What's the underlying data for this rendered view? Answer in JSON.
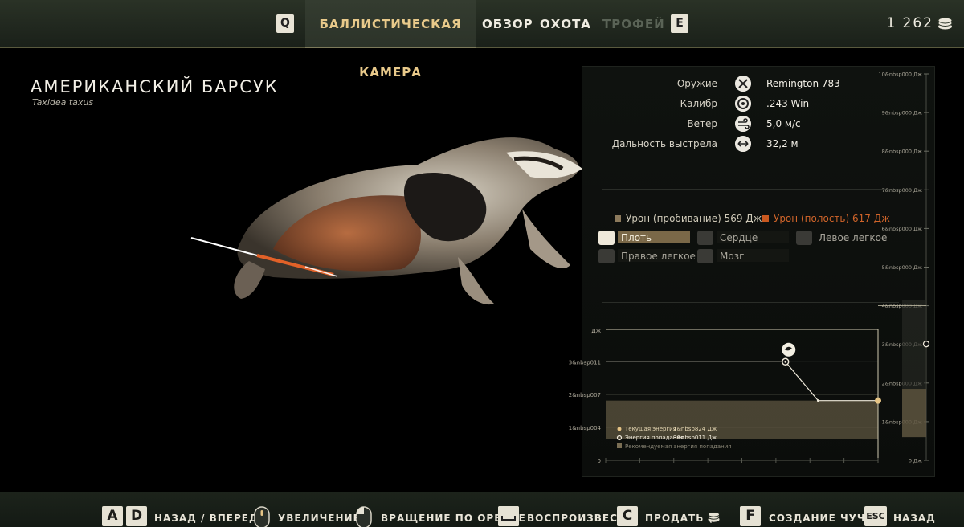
{
  "tabs": {
    "prev_key": "Q",
    "next_key": "E",
    "items": [
      {
        "label": "БАЛЛИСТИЧЕСКАЯ КАМЕРА"
      },
      {
        "label": "ОБЗОР"
      },
      {
        "label": "ОХОТА"
      },
      {
        "label": "ТРОФЕЙ"
      }
    ]
  },
  "currency": {
    "amount": "1 262",
    "icon": "coins-icon"
  },
  "animal": {
    "name": "АМЕРИКАНСКИЙ БАРСУК",
    "latin": "Taxidea taxus"
  },
  "stats": [
    {
      "label": "Оружие",
      "value": "Remington 783",
      "icon": "rifle-icon"
    },
    {
      "label": "Калибр",
      "value": ".243 Win",
      "icon": "caliber-icon"
    },
    {
      "label": "Ветер",
      "value": "5,0 м/с",
      "icon": "wind-icon"
    },
    {
      "label": "Дальность выстрела",
      "value": "32,2 м",
      "icon": "distance-icon"
    }
  ],
  "damage": {
    "penetration": "Урон (пробивание) 569 Дж",
    "expansion": "Урон (полость) 617 Дж",
    "penetration_color": "#8c7a5c",
    "expansion_color": "#c9581f"
  },
  "organs": [
    {
      "label": "Плоть",
      "icon": "flesh-icon",
      "active": true
    },
    {
      "label": "Сердце",
      "icon": "heart-icon",
      "active": false
    },
    {
      "label": "Левое легкое",
      "icon": "lung-icon",
      "active": false
    },
    {
      "label": "Правое легкое",
      "icon": "lung-icon",
      "active": false
    },
    {
      "label": "Мозг",
      "icon": "brain-icon",
      "active": false
    }
  ],
  "chart_data": {
    "type": "line",
    "ylabel": "Дж",
    "y_ticks": [
      "3&nbsp011",
      "2&nbsp007",
      "1&nbsp004",
      "0"
    ],
    "right_axis_ticks": [
      "10&nbsp000 Дж",
      "9&nbsp000 Дж",
      "8&nbsp000 Дж",
      "7&nbsp000 Дж",
      "6&nbsp000 Дж",
      "5&nbsp000 Дж",
      "4&nbsp000 Дж",
      "3&nbsp000 Дж",
      "2&nbsp000 Дж",
      "1&nbsp000 Дж",
      "0 Дж"
    ],
    "ylim": [
      0,
      4000
    ],
    "right_ylim": [
      0,
      10000
    ],
    "series": [
      {
        "name": "Текущая энергия",
        "value_label": "1&nbsp824 Дж",
        "points": [
          [
            0,
            3011
          ],
          [
            0.66,
            3011
          ],
          [
            0.78,
            1824
          ],
          [
            1,
            1824
          ]
        ]
      },
      {
        "name": "Энергия попадания",
        "value_label": "3&nbsp011 Дж",
        "value": 3011
      }
    ],
    "recommended_band": {
      "name": "Рекомендуемая энергия попадания",
      "min": 657,
      "max": 1824
    },
    "right_band": {
      "min": 600,
      "max": 1850
    },
    "right_marker_value": 3011,
    "marker_icon": "flesh-icon",
    "accent_color": "#e6c485"
  },
  "bottom_actions": [
    {
      "keys": [
        "A",
        "D"
      ],
      "label": "НАЗАД / ВПЕРЕД"
    },
    {
      "icon": "mouse-scroll-icon",
      "label": "УВЕЛИЧЕНИЕ"
    },
    {
      "icon": "mouse-left-icon",
      "label": "ВРАЩЕНИЕ ПО ОРБИТЕ"
    },
    {
      "keys": [
        "space"
      ],
      "label": "ВОСПРОИЗВЕСТИ"
    },
    {
      "keys": [
        "C"
      ],
      "label": "ПРОДАТЬ (3"
    },
    {
      "keys": [
        "F"
      ],
      "label": "СОЗДАНИЕ ЧУЧЕЛ"
    },
    {
      "keys": [
        "ESC"
      ],
      "label": "НАЗАД"
    }
  ],
  "colors": {
    "accent": "#e6c485",
    "bar_bg": "#1f261d"
  }
}
